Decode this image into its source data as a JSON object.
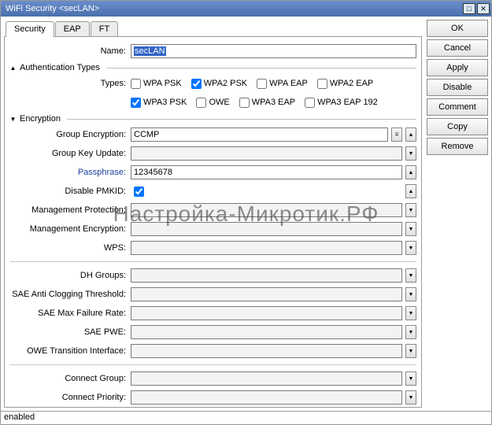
{
  "title": "WiFi Security <secLAN>",
  "tabs": {
    "security": "Security",
    "eap": "EAP",
    "ft": "FT"
  },
  "buttons": {
    "ok": "OK",
    "cancel": "Cancel",
    "apply": "Apply",
    "disable": "Disable",
    "comment": "Comment",
    "copy": "Copy",
    "remove": "Remove"
  },
  "labels": {
    "name": "Name:",
    "auth_types": "Authentication Types",
    "types": "Types:",
    "encryption": "Encryption",
    "group_encryption": "Group Encryption:",
    "group_key_update": "Group Key Update:",
    "passphrase": "Passphrase:",
    "disable_pmkid": "Disable PMKID:",
    "mgmt_protection": "Management Protection:",
    "mgmt_encryption": "Management Encryption:",
    "wps": "WPS:",
    "dh_groups": "DH Groups:",
    "sae_anti": "SAE Anti Clogging Threshold:",
    "sae_max_fail": "SAE Max Failure Rate:",
    "sae_pwe": "SAE PWE:",
    "owe_transition": "OWE Transition Interface:",
    "connect_group": "Connect Group:",
    "connect_priority": "Connect Priority:"
  },
  "values": {
    "name": "secLAN",
    "group_encryption": "CCMP",
    "group_key_update": "",
    "passphrase": "12345678",
    "mgmt_protection": "",
    "mgmt_encryption": "",
    "wps": "",
    "dh_groups": "",
    "sae_anti": "",
    "sae_max_fail": "",
    "sae_pwe": "",
    "owe_transition": "",
    "connect_group": "",
    "connect_priority": ""
  },
  "types": {
    "wpa_psk": {
      "label": "WPA PSK",
      "checked": false
    },
    "wpa2_psk": {
      "label": "WPA2 PSK",
      "checked": true
    },
    "wpa_eap": {
      "label": "WPA EAP",
      "checked": false
    },
    "wpa2_eap": {
      "label": "WPA2 EAP",
      "checked": false
    },
    "wpa3_psk": {
      "label": "WPA3 PSK",
      "checked": true
    },
    "owe": {
      "label": "OWE",
      "checked": false
    },
    "wpa3_eap": {
      "label": "WPA3 EAP",
      "checked": false
    },
    "wpa3_eap192": {
      "label": "WPA3 EAP 192",
      "checked": false
    }
  },
  "disable_pmkid_checked": true,
  "status": "enabled",
  "watermark": "Настройка-Микротик.РФ"
}
